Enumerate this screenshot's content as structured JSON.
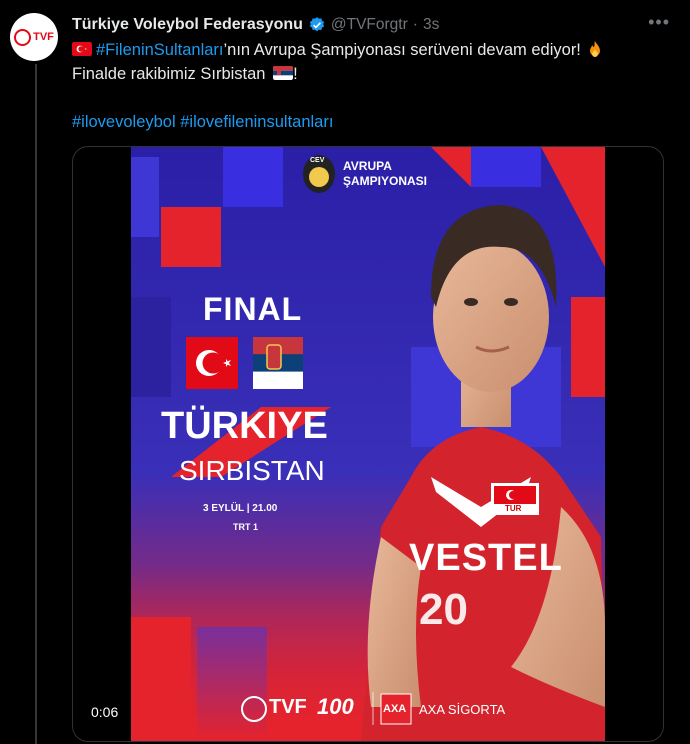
{
  "tweet": {
    "author_name": "Türkiye Voleybol Federasyonu",
    "handle": "@TVForgtr",
    "separator": "·",
    "time": "3s",
    "more_label": "•••",
    "avatar_text": "TVF",
    "hashtag_main": "#FileninSultanları",
    "line1_rest": "’nın Avrupa Şampiyonası serüveni devam ediyor!",
    "line2_text": "Finalde rakibimiz Sırbistan",
    "line2_end": "!",
    "hashtag_1": "#ilovevoleybol",
    "hashtag_2": "#ilovefileninsultanları"
  },
  "media": {
    "timecode": "0:06",
    "poster": {
      "cev_badge": "CEV",
      "championship_line1": "AVRUPA",
      "championship_line2": "ŞAMPIYONASI",
      "final_label": "FINAL",
      "team_home": "TÜRKIYE",
      "team_away": "SIRBISTAN",
      "date_time": "3 EYLÜL | 21.00",
      "channel": "TRT 1",
      "jersey_brand": "VESTEL",
      "jersey_number": "20",
      "jersey_badge": "TUR",
      "sponsor_tvf": "TVF",
      "sponsor_axa_logo": "AXA",
      "sponsor_axa": "AXA SİGORTA",
      "centenary": "100"
    }
  },
  "colors": {
    "background": "#000000",
    "link": "#1d9bf0",
    "muted": "#71767b",
    "poster_blue": "#2b22a8",
    "poster_red": "#e5232c"
  }
}
